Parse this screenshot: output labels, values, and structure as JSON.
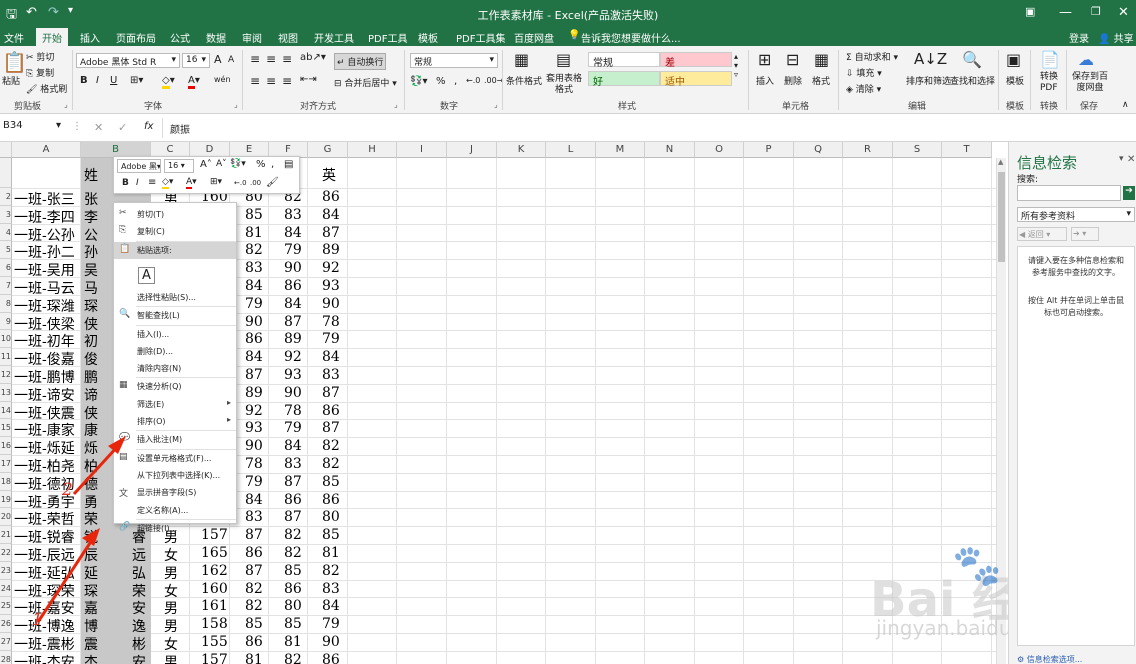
{
  "window": {
    "title": "工作表素材库 - Excel(产品激活失败)",
    "login": "登录",
    "share": "共享"
  },
  "tabs": [
    "文件",
    "开始",
    "插入",
    "页面布局",
    "公式",
    "数据",
    "审阅",
    "视图",
    "开发工具",
    "PDF工具",
    "模板",
    "PDF工具集",
    "百度网盘"
  ],
  "tell_me": "告诉我您想要做什么...",
  "ribbon": {
    "clipboard": {
      "paste": "粘贴",
      "cut": "剪切",
      "copy": "复制",
      "format_painter": "格式刷",
      "label": "剪贴板"
    },
    "font": {
      "name": "Adobe 黑体 Std R",
      "size": "16",
      "bold": "B",
      "italic": "I",
      "underline": "U",
      "grow": "A",
      "shrink": "A",
      "wen": "wén",
      "label": "字体"
    },
    "align": {
      "wrap": "自动换行",
      "merge": "合并后居中",
      "label": "对齐方式"
    },
    "number": {
      "format": "常规",
      "percent": "%",
      "comma": ",",
      "label": "数字"
    },
    "styles": {
      "conditional": "条件格式",
      "table": "套用表格格式",
      "normal": "常规",
      "bad": "差",
      "good": "好",
      "neutral": "适中",
      "label": "样式"
    },
    "cells": {
      "insert": "插入",
      "delete": "删除",
      "format": "格式",
      "label": "单元格"
    },
    "editing": {
      "autosum": "自动求和",
      "fill": "填充",
      "clear": "清除",
      "sort": "排序和筛选",
      "find": "查找和选择",
      "label": "编辑"
    },
    "template": {
      "btn": "模板",
      "label": "模板"
    },
    "convert": {
      "btn": "转换PDF",
      "label": "转换"
    },
    "save": {
      "btn": "保存到百度网盘",
      "label": "保存"
    }
  },
  "formula_bar": {
    "name_box": "B34",
    "fx": "fx",
    "value": "颜振"
  },
  "columns": [
    "A",
    "B",
    "C",
    "D",
    "E",
    "F",
    "G",
    "H",
    "I",
    "J",
    "K",
    "L",
    "M",
    "N",
    "O",
    "P",
    "Q",
    "R",
    "S",
    "T"
  ],
  "header_row": {
    "B": "姓",
    "G": "英"
  },
  "rows": [
    {
      "n": "2",
      "a": "一班-张三",
      "b": "张",
      "c": "男",
      "d": "160",
      "e": "80",
      "f": "82",
      "g": "86"
    },
    {
      "n": "3",
      "a": "一班-李四",
      "b": "李",
      "c": "",
      "d": "",
      "e": "85",
      "f": "83",
      "g": "84"
    },
    {
      "n": "4",
      "a": "一班-公孙",
      "b": "公",
      "c": "",
      "d": "",
      "e": "81",
      "f": "84",
      "g": "87"
    },
    {
      "n": "5",
      "a": "一班-孙二",
      "b": "孙",
      "c": "",
      "d": "",
      "e": "82",
      "f": "79",
      "g": "89"
    },
    {
      "n": "6",
      "a": "一班-吴用",
      "b": "吴",
      "c": "",
      "d": "",
      "e": "83",
      "f": "90",
      "g": "92"
    },
    {
      "n": "7",
      "a": "一班-马云",
      "b": "马",
      "c": "",
      "d": "",
      "e": "84",
      "f": "86",
      "g": "93"
    },
    {
      "n": "8",
      "a": "一班-琛潍",
      "b": "琛",
      "c": "",
      "d": "",
      "e": "79",
      "f": "84",
      "g": "90"
    },
    {
      "n": "9",
      "a": "一班-侠梁",
      "b": "侠",
      "c": "",
      "d": "",
      "e": "90",
      "f": "87",
      "g": "78"
    },
    {
      "n": "10",
      "a": "一班-初年",
      "b": "初",
      "c": "",
      "d": "",
      "e": "86",
      "f": "89",
      "g": "79"
    },
    {
      "n": "11",
      "a": "一班-俊嘉",
      "b": "俊",
      "c": "",
      "d": "",
      "e": "84",
      "f": "92",
      "g": "84"
    },
    {
      "n": "12",
      "a": "一班-鹏博",
      "b": "鹏",
      "c": "",
      "d": "",
      "e": "87",
      "f": "93",
      "g": "83"
    },
    {
      "n": "13",
      "a": "一班-谛安",
      "b": "谛",
      "c": "",
      "d": "",
      "e": "89",
      "f": "90",
      "g": "87"
    },
    {
      "n": "14",
      "a": "一班-侠震",
      "b": "侠",
      "c": "",
      "d": "",
      "e": "92",
      "f": "78",
      "g": "86"
    },
    {
      "n": "15",
      "a": "一班-康家",
      "b": "康",
      "c": "",
      "d": "",
      "e": "93",
      "f": "79",
      "g": "87"
    },
    {
      "n": "16",
      "a": "一班-烁延",
      "b": "烁",
      "c": "",
      "d": "",
      "e": "90",
      "f": "84",
      "g": "82"
    },
    {
      "n": "17",
      "a": "一班-柏尧",
      "b": "柏",
      "c": "",
      "d": "",
      "e": "78",
      "f": "83",
      "g": "82"
    },
    {
      "n": "18",
      "a": "一班-德初",
      "b": "德",
      "c": "",
      "d": "",
      "e": "79",
      "f": "87",
      "g": "85"
    },
    {
      "n": "19",
      "a": "一班-勇宇",
      "b": "勇",
      "c": "",
      "d": "",
      "e": "84",
      "f": "86",
      "g": "86"
    },
    {
      "n": "20",
      "a": "一班-荣哲",
      "b": "荣",
      "c": "",
      "d": "",
      "e": "83",
      "f": "87",
      "g": "80"
    },
    {
      "n": "21",
      "a": "一班-锐睿",
      "b": "锐",
      "b2": "睿",
      "c": "男",
      "d": "157",
      "e": "87",
      "f": "82",
      "g": "85"
    },
    {
      "n": "22",
      "a": "一班-辰远",
      "b": "辰",
      "b2": "远",
      "c": "女",
      "d": "165",
      "e": "86",
      "f": "82",
      "g": "81"
    },
    {
      "n": "23",
      "a": "一班-延弘",
      "b": "延",
      "b2": "弘",
      "c": "男",
      "d": "162",
      "e": "87",
      "f": "85",
      "g": "82"
    },
    {
      "n": "24",
      "a": "一班-琛荣",
      "b": "琛",
      "b2": "荣",
      "c": "女",
      "d": "160",
      "e": "82",
      "f": "86",
      "g": "83"
    },
    {
      "n": "25",
      "a": "一班-嘉安",
      "b": "嘉",
      "b2": "安",
      "c": "男",
      "d": "161",
      "e": "82",
      "f": "80",
      "g": "84"
    },
    {
      "n": "26",
      "a": "一班-博逸",
      "b": "博",
      "b2": "逸",
      "c": "男",
      "d": "158",
      "e": "85",
      "f": "85",
      "g": "79"
    },
    {
      "n": "27",
      "a": "一班-震彬",
      "b": "震",
      "b2": "彬",
      "c": "女",
      "d": "155",
      "e": "86",
      "f": "81",
      "g": "90"
    },
    {
      "n": "28",
      "a": "一班-杰安",
      "b": "杰",
      "b2": "安",
      "c": "男",
      "d": "157",
      "e": "81",
      "f": "82",
      "g": "86"
    }
  ],
  "mini_toolbar": {
    "font": "Adobe 黑",
    "size": "16",
    "bold": "B",
    "italic": "I",
    "align": "≡",
    "percent": "%",
    "comma": ","
  },
  "context_menu": [
    {
      "label": "剪切(T)",
      "icon": "✂"
    },
    {
      "label": "复制(C)",
      "icon": "⎘"
    },
    {
      "label": "粘贴选项:",
      "icon": "📋",
      "highlight": true
    },
    {
      "label": "A",
      "icon": ""
    },
    {
      "label": "选择性粘贴(S)...",
      "icon": ""
    },
    {
      "label": "智能查找(L)",
      "icon": "🔍"
    },
    {
      "label": "插入(I)...",
      "icon": ""
    },
    {
      "label": "删除(D)...",
      "icon": ""
    },
    {
      "label": "清除内容(N)",
      "icon": ""
    },
    {
      "label": "快速分析(Q)",
      "icon": "▦"
    },
    {
      "label": "筛选(E)",
      "icon": "",
      "arrow": "▸"
    },
    {
      "label": "排序(O)",
      "icon": "",
      "arrow": "▸"
    },
    {
      "label": "插入批注(M)",
      "icon": "💬"
    },
    {
      "label": "设置单元格格式(F)...",
      "icon": "▤"
    },
    {
      "label": "从下拉列表中选择(K)...",
      "icon": ""
    },
    {
      "label": "显示拼音字段(S)",
      "icon": "文"
    },
    {
      "label": "定义名称(A)...",
      "icon": ""
    },
    {
      "label": "超链接(I)...",
      "icon": "🔗"
    }
  ],
  "pane": {
    "title": "信息检索",
    "search_label": "搜索:",
    "source": "所有参考资料",
    "back": "返回",
    "help1": "请键入要在多种信息检索和参考服务中查找的文字。",
    "help2": "按住 Alt 并在单词上单击鼠标也可启动搜索。",
    "footer": "信息检索选项..."
  },
  "annotations": {
    "n1": "1",
    "n2": "2"
  },
  "watermark": {
    "brand": "Bai  经验",
    "url": "jingyan.baidu.com"
  }
}
